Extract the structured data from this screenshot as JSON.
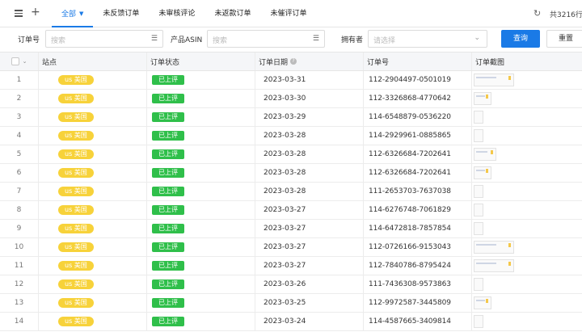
{
  "topbar": {
    "tabs": [
      {
        "label": "全部",
        "active": true
      },
      {
        "label": "未反馈订单",
        "active": false
      },
      {
        "label": "未审核评论",
        "active": false
      },
      {
        "label": "未返款订单",
        "active": false
      },
      {
        "label": "未催评订单",
        "active": false
      }
    ],
    "total_text": "共3216行"
  },
  "filter": {
    "order_no_label": "订单号",
    "order_no_placeholder": "搜索",
    "asin_label": "产品ASIN",
    "asin_placeholder": "搜索",
    "owner_label": "拥有者",
    "owner_placeholder": "请选择",
    "query_label": "查询",
    "reset_label": "重置"
  },
  "table": {
    "headers": [
      "站点",
      "订单状态",
      "订单日期",
      "订单号",
      "订单截图"
    ],
    "rows": [
      {
        "index": "1",
        "site": "us 美国",
        "status": "已上评",
        "date": "2023-03-31",
        "order_no": "112-2904497-0501019",
        "thumb": "wide"
      },
      {
        "index": "2",
        "site": "us 美国",
        "status": "已上评",
        "date": "2023-03-30",
        "order_no": "112-3326868-4770642",
        "thumb": "small"
      },
      {
        "index": "3",
        "site": "us 美国",
        "status": "已上评",
        "date": "2023-03-29",
        "order_no": "114-6548879-0536220",
        "thumb": "tiny"
      },
      {
        "index": "4",
        "site": "us 美国",
        "status": "已上评",
        "date": "2023-03-28",
        "order_no": "114-2929961-0885865",
        "thumb": "tiny"
      },
      {
        "index": "5",
        "site": "us 美国",
        "status": "已上评",
        "date": "2023-03-28",
        "order_no": "112-6326684-7202641",
        "thumb": "medium"
      },
      {
        "index": "6",
        "site": "us 美国",
        "status": "已上评",
        "date": "2023-03-28",
        "order_no": "112-6326684-7202641",
        "thumb": "small"
      },
      {
        "index": "7",
        "site": "us 美国",
        "status": "已上评",
        "date": "2023-03-28",
        "order_no": "111-2653703-7637038",
        "thumb": "tiny"
      },
      {
        "index": "8",
        "site": "us 美国",
        "status": "已上评",
        "date": "2023-03-27",
        "order_no": "114-6276748-7061829",
        "thumb": "tiny"
      },
      {
        "index": "9",
        "site": "us 美国",
        "status": "已上评",
        "date": "2023-03-27",
        "order_no": "114-6472818-7857854",
        "thumb": "tiny"
      },
      {
        "index": "10",
        "site": "us 美国",
        "status": "已上评",
        "date": "2023-03-27",
        "order_no": "112-0726166-9153043",
        "thumb": "wide"
      },
      {
        "index": "11",
        "site": "us 美国",
        "status": "已上评",
        "date": "2023-03-27",
        "order_no": "112-7840786-8795424",
        "thumb": "wide"
      },
      {
        "index": "12",
        "site": "us 美国",
        "status": "已上评",
        "date": "2023-03-26",
        "order_no": "111-7436308-9573863",
        "thumb": "tiny"
      },
      {
        "index": "13",
        "site": "us 美国",
        "status": "已上评",
        "date": "2023-03-25",
        "order_no": "112-9972587-3445809",
        "thumb": "small"
      },
      {
        "index": "14",
        "site": "us 美国",
        "status": "已上评",
        "date": "2023-03-24",
        "order_no": "114-4587665-3409814",
        "thumb": "tiny"
      }
    ]
  },
  "colors": {
    "accent": "#1a7ae6",
    "site_badge": "#f7d23a",
    "status_badge": "#2fbf4a"
  }
}
